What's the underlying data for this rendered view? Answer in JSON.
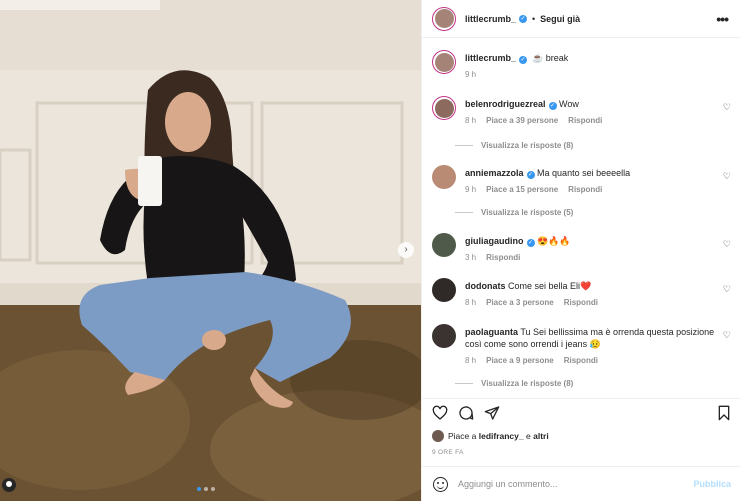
{
  "post": {
    "username": "littlecrumb_",
    "follow_separator": "•",
    "follow_label": "Segui già",
    "more_label": "•••",
    "caption_emoji": "☕",
    "caption_text": "break",
    "caption_time": "9 h"
  },
  "photo": {
    "next_label": "›",
    "dots_total": 3,
    "dots_active": 1
  },
  "comments": [
    {
      "username": "belenrodriguezreal",
      "verified": true,
      "text": "Wow",
      "time": "8 h",
      "likes": "Piace a 39 persone",
      "reply": "Rispondi",
      "replies": "Visualizza le risposte (8)"
    },
    {
      "username": "anniemazzola",
      "verified": true,
      "text": "Ma quanto sei beeeella",
      "time": "9 h",
      "likes": "Piace a 15 persone",
      "reply": "Rispondi",
      "replies": "Visualizza le risposte (5)"
    },
    {
      "username": "giuliagaudino",
      "verified": true,
      "text": "😍🔥🔥",
      "time": "3 h",
      "likes": "",
      "reply": "Rispondi",
      "replies": ""
    },
    {
      "username": "dodonats",
      "verified": false,
      "text": "Come sei bella Eli❤️",
      "time": "8 h",
      "likes": "Piace a 3 persone",
      "reply": "Rispondi",
      "replies": ""
    },
    {
      "username": "paolaguanta",
      "verified": false,
      "text": "Tu Sei bellissima ma è orrenda questa posizione così come sono orrendi i jeans 😥",
      "time": "8 h",
      "likes": "Piace a 9 persone",
      "reply": "Rispondi",
      "replies": "Visualizza le risposte (8)"
    }
  ],
  "likes_line": {
    "prefix": "Piace a",
    "user": "ledifrancy_",
    "connector": "e",
    "others": "altri"
  },
  "timestamp": "9 ORE FA",
  "add_comment": {
    "placeholder": "Aggiungi un commento...",
    "publish_label": "Pubblica"
  },
  "colors": {
    "accent": "#3897f0",
    "publish_disabled": "#b2dffc",
    "muted": "#8e8e8e",
    "ring": "#c13584"
  },
  "icons": [
    "heart-icon",
    "comment-icon",
    "share-icon",
    "bookmark-icon",
    "emoji-icon",
    "more-icon",
    "verified-icon",
    "tag-icon"
  ]
}
